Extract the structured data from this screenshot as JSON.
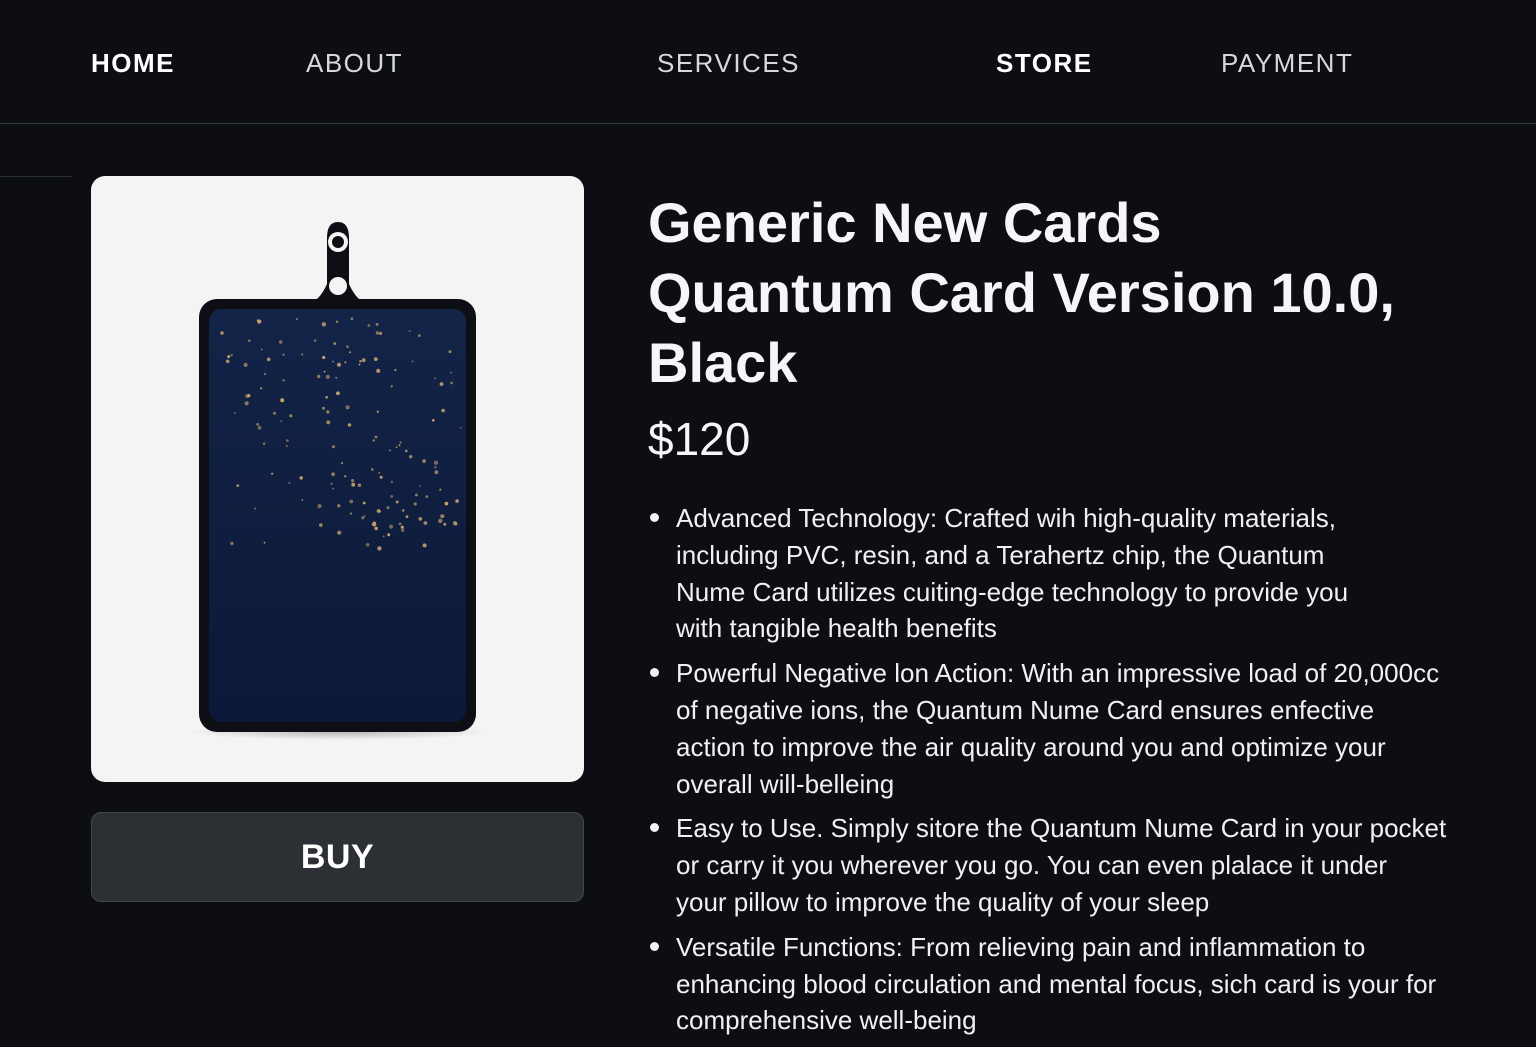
{
  "nav": {
    "home": "HOME",
    "about": "ABOUT",
    "services": "SERVICES",
    "store": "STORE",
    "payment": "PAYMENT"
  },
  "product": {
    "title_lines": [
      "Generic New Cards",
      "Quantum Card Version 10.0,",
      "Black"
    ],
    "price": "$120",
    "buy_label": "BUY",
    "image_icon": "quantum-card-pendant"
  },
  "features": [
    {
      "lines": [
        "Advanced Technology: Crafted wih high-quality materials,",
        "including PVC, resin, and a Terahertz chip, the Quantum",
        "Nume Card utilizes cuiting-edge technology to provide you",
        "with tangible health benefits"
      ]
    },
    {
      "lines": [
        "Powerful Negative lon Action: With an impressive load of 20,000cc",
        "of negative ions, the Quantum Nume Card ensures enfective",
        "action to improve the air quality around you and optimize your",
        "overall will-belleing"
      ]
    },
    {
      "lines": [
        "Easy to Use. Simply sitore the Quantum Nume Card in your pocket",
        "or carry it you wherever you go. You can even plalace it under",
        "your pillow to improve the quality of your sleep"
      ]
    },
    {
      "lines": [
        "Versatile Functions: From relieving pain and inflammation to",
        "enhancing blood circulation and mental focus, sich card is your for",
        "comprehensive well-being"
      ]
    }
  ],
  "colors": {
    "background": "#0c0e13",
    "button": "#2c2f34",
    "card_face": "#0f1d3d",
    "speckle": "#c9a46a"
  }
}
